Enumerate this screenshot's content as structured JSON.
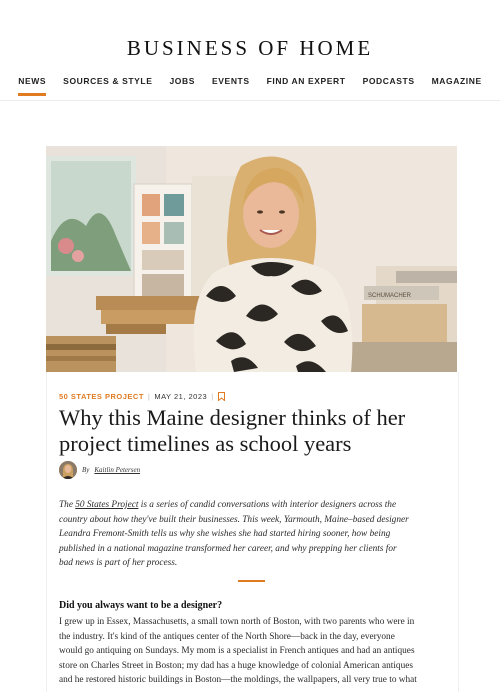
{
  "site": {
    "logo": "BUSINESS OF HOME",
    "nav": [
      {
        "label": "NEWS",
        "active": true
      },
      {
        "label": "SOURCES & STYLE",
        "active": false
      },
      {
        "label": "JOBS",
        "active": false
      },
      {
        "label": "EVENTS",
        "active": false
      },
      {
        "label": "FIND AN EXPERT",
        "active": false
      },
      {
        "label": "PODCASTS",
        "active": false
      },
      {
        "label": "MAGAZINE",
        "active": false
      }
    ],
    "accent_color": "#e07b22"
  },
  "article": {
    "category": "50 STATES PROJECT",
    "date": "MAY 21, 2023",
    "headline_lines": [
      "Why this Maine designer thinks of her",
      "project timelines as school years"
    ],
    "byline_prefix": "By",
    "author": "Kaitlin Petersen",
    "intro": {
      "line1_pre": "The ",
      "line1_link": "50 States Project",
      "line1_post": " is a series of candid conversations with interior designers across the",
      "lines": [
        "country about how they've built their businesses. This week, Yarmouth, Maine–based designer",
        "Leandra Fremont-Smith tells us why she wishes she had started hiring sooner, how being",
        "published in a national magazine transformed her career, and why prepping her clients for",
        "bad news is part of her process."
      ]
    },
    "question": "Did you always want to be a designer?",
    "answer_lines": [
      "I grew up in Essex, Massachusetts, a small town north of Boston, with two parents who were in",
      "the industry. It's kind of the antiques center of the North Shore—back in the day, everyone",
      "would go antiquing on Sundays. My mom is a specialist in French antiques and had an antiques",
      "store on Charles Street in Boston; my dad has a huge knowledge of colonial American antiques",
      "and he restored historic buildings in Boston—the moldings, the wallpapers, all very true to what"
    ],
    "hero_box_label": "SCHUMACHER"
  },
  "icons": {
    "bookmark": "bookmark-icon",
    "avatar": "author-avatar"
  }
}
